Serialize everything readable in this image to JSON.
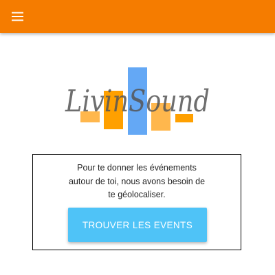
{
  "header": {
    "menu_icon": "hamburger-menu-icon",
    "bar_color": "#f57c00"
  },
  "logo": {
    "wordmark": "LivinSound",
    "bar_colors": [
      "#ffb74d",
      "#ffa000",
      "#64a8f5"
    ]
  },
  "card": {
    "message": "Pour te donner les événements\nautour de toi, nous avons besoin de\nte géolocaliser.",
    "button_label": "TROUVER LES EVENTS",
    "button_color": "#4fc3f7"
  }
}
